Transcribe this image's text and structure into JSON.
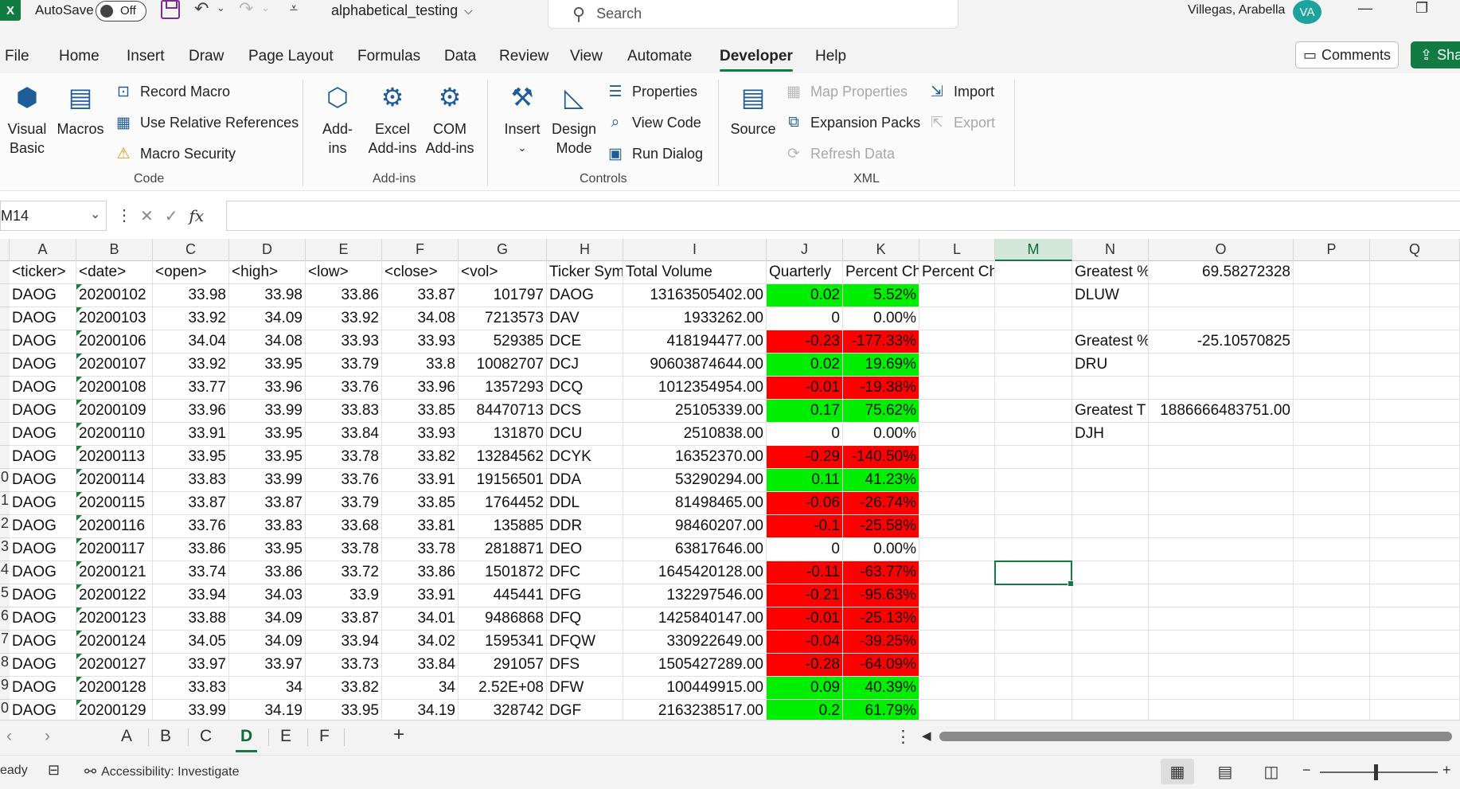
{
  "title_bar": {
    "app_logo": "X",
    "autosave_label": "AutoSave",
    "autosave_state": "Off",
    "doc_name": "alphabetical_testing",
    "search_placeholder": "Search",
    "user_name": "Villegas, Arabella",
    "user_initials": "VA"
  },
  "menu_tabs": [
    {
      "label": "File"
    },
    {
      "label": "Home"
    },
    {
      "label": "Insert"
    },
    {
      "label": "Draw"
    },
    {
      "label": "Page Layout"
    },
    {
      "label": "Formulas"
    },
    {
      "label": "Data"
    },
    {
      "label": "Review"
    },
    {
      "label": "View"
    },
    {
      "label": "Automate"
    },
    {
      "label": "Developer",
      "active": true
    },
    {
      "label": "Help"
    }
  ],
  "header_buttons": {
    "comments": "Comments",
    "share": "Sha"
  },
  "ribbon": {
    "code": {
      "label": "Code",
      "visual_basic_1": "Visual",
      "visual_basic_2": "Basic",
      "macros": "Macros",
      "record_macro": "Record Macro",
      "use_relative": "Use Relative References",
      "macro_security": "Macro Security"
    },
    "addins": {
      "label": "Add-ins",
      "addins_1": "Add-",
      "addins_2": "ins",
      "excel_addins_1": "Excel",
      "excel_addins_2": "Add-ins",
      "com_addins_1": "COM",
      "com_addins_2": "Add-ins"
    },
    "controls": {
      "label": "Controls",
      "insert": "Insert",
      "design_mode_1": "Design",
      "design_mode_2": "Mode",
      "properties": "Properties",
      "view_code": "View Code",
      "run_dialog": "Run Dialog"
    },
    "xml": {
      "label": "XML",
      "source": "Source",
      "map_properties": "Map Properties",
      "expansion_packs": "Expansion Packs",
      "refresh_data": "Refresh Data",
      "import": "Import",
      "export": "Export"
    }
  },
  "name_box": "M14",
  "columns": [
    "A",
    "B",
    "C",
    "D",
    "E",
    "F",
    "G",
    "H",
    "I",
    "J",
    "K",
    "L",
    "M",
    "N",
    "O",
    "P",
    "Q"
  ],
  "selected_column": "M",
  "row_numbers_visible": [
    "",
    "",
    "",
    "",
    "",
    "",
    "",
    "",
    "",
    "0",
    "1",
    "2",
    "3",
    "4",
    "5",
    "6",
    "7",
    "8",
    "9",
    "0"
  ],
  "header_row": [
    "<ticker>",
    "<date>",
    "<open>",
    "<high>",
    "<low>",
    "<close>",
    "<vol>",
    "Ticker Sym",
    "Total Volume",
    "Quarterly",
    "Percent Ch",
    "Percent Change (%)",
    "",
    "Greatest %",
    "69.58272328"
  ],
  "rows": [
    {
      "a": "DAOG",
      "b": "20200102",
      "c": "33.98",
      "d": "33.98",
      "e": "33.86",
      "f": "33.87",
      "g": "101797",
      "h": "DAOG",
      "i": "13163505402.00",
      "j": "0.02",
      "k": "5.52%",
      "status": "green",
      "n": "DLUW",
      "o": ""
    },
    {
      "a": "DAOG",
      "b": "20200103",
      "c": "33.92",
      "d": "34.09",
      "e": "33.92",
      "f": "34.08",
      "g": "7213573",
      "h": "DAV",
      "i": "1933262.00",
      "j": "0",
      "k": "0.00%",
      "status": "none",
      "n": "",
      "o": ""
    },
    {
      "a": "DAOG",
      "b": "20200106",
      "c": "34.04",
      "d": "34.08",
      "e": "33.93",
      "f": "33.93",
      "g": "529385",
      "h": "DCE",
      "i": "418194477.00",
      "j": "-0.23",
      "k": "-177.33%",
      "status": "red",
      "n": "Greatest %",
      "o": "-25.10570825"
    },
    {
      "a": "DAOG",
      "b": "20200107",
      "c": "33.92",
      "d": "33.95",
      "e": "33.79",
      "f": "33.8",
      "g": "10082707",
      "h": "DCJ",
      "i": "90603874644.00",
      "j": "0.02",
      "k": "19.69%",
      "status": "green",
      "n": "DRU",
      "o": ""
    },
    {
      "a": "DAOG",
      "b": "20200108",
      "c": "33.77",
      "d": "33.96",
      "e": "33.76",
      "f": "33.96",
      "g": "1357293",
      "h": "DCQ",
      "i": "1012354954.00",
      "j": "-0.01",
      "k": "-19.38%",
      "status": "red",
      "n": "",
      "o": ""
    },
    {
      "a": "DAOG",
      "b": "20200109",
      "c": "33.96",
      "d": "33.99",
      "e": "33.83",
      "f": "33.85",
      "g": "84470713",
      "h": "DCS",
      "i": "25105339.00",
      "j": "0.17",
      "k": "75.62%",
      "status": "green",
      "n": "Greatest T",
      "o": "1886666483751.00"
    },
    {
      "a": "DAOG",
      "b": "20200110",
      "c": "33.91",
      "d": "33.95",
      "e": "33.84",
      "f": "33.93",
      "g": "131870",
      "h": "DCU",
      "i": "2510838.00",
      "j": "0",
      "k": "0.00%",
      "status": "none",
      "n": "DJH",
      "o": ""
    },
    {
      "a": "DAOG",
      "b": "20200113",
      "c": "33.95",
      "d": "33.95",
      "e": "33.78",
      "f": "33.82",
      "g": "13284562",
      "h": "DCYK",
      "i": "16352370.00",
      "j": "-0.29",
      "k": "-140.50%",
      "status": "red",
      "n": "",
      "o": ""
    },
    {
      "a": "DAOG",
      "b": "20200114",
      "c": "33.83",
      "d": "33.99",
      "e": "33.76",
      "f": "33.91",
      "g": "19156501",
      "h": "DDA",
      "i": "53290294.00",
      "j": "0.11",
      "k": "41.23%",
      "status": "green",
      "n": "",
      "o": ""
    },
    {
      "a": "DAOG",
      "b": "20200115",
      "c": "33.87",
      "d": "33.87",
      "e": "33.79",
      "f": "33.85",
      "g": "1764452",
      "h": "DDL",
      "i": "81498465.00",
      "j": "-0.06",
      "k": "-26.74%",
      "status": "red",
      "n": "",
      "o": ""
    },
    {
      "a": "DAOG",
      "b": "20200116",
      "c": "33.76",
      "d": "33.83",
      "e": "33.68",
      "f": "33.81",
      "g": "135885",
      "h": "DDR",
      "i": "98460207.00",
      "j": "-0.1",
      "k": "-25.58%",
      "status": "red",
      "n": "",
      "o": ""
    },
    {
      "a": "DAOG",
      "b": "20200117",
      "c": "33.86",
      "d": "33.95",
      "e": "33.78",
      "f": "33.78",
      "g": "2818871",
      "h": "DEO",
      "i": "63817646.00",
      "j": "0",
      "k": "0.00%",
      "status": "none",
      "n": "",
      "o": ""
    },
    {
      "a": "DAOG",
      "b": "20200121",
      "c": "33.74",
      "d": "33.86",
      "e": "33.72",
      "f": "33.86",
      "g": "1501872",
      "h": "DFC",
      "i": "1645420128.00",
      "j": "-0.11",
      "k": "-63.77%",
      "status": "red",
      "n": "",
      "o": ""
    },
    {
      "a": "DAOG",
      "b": "20200122",
      "c": "33.94",
      "d": "34.03",
      "e": "33.9",
      "f": "33.91",
      "g": "445441",
      "h": "DFG",
      "i": "132297546.00",
      "j": "-0.21",
      "k": "-95.63%",
      "status": "red",
      "n": "",
      "o": ""
    },
    {
      "a": "DAOG",
      "b": "20200123",
      "c": "33.88",
      "d": "34.09",
      "e": "33.87",
      "f": "34.01",
      "g": "9486868",
      "h": "DFQ",
      "i": "1425840147.00",
      "j": "-0.01",
      "k": "-25.13%",
      "status": "red",
      "n": "",
      "o": ""
    },
    {
      "a": "DAOG",
      "b": "20200124",
      "c": "34.05",
      "d": "34.09",
      "e": "33.94",
      "f": "34.02",
      "g": "1595341",
      "h": "DFQW",
      "i": "330922649.00",
      "j": "-0.04",
      "k": "-39.25%",
      "status": "red",
      "n": "",
      "o": ""
    },
    {
      "a": "DAOG",
      "b": "20200127",
      "c": "33.97",
      "d": "33.97",
      "e": "33.73",
      "f": "33.84",
      "g": "291057",
      "h": "DFS",
      "i": "1505427289.00",
      "j": "-0.28",
      "k": "-64.09%",
      "status": "red",
      "n": "",
      "o": ""
    },
    {
      "a": "DAOG",
      "b": "20200128",
      "c": "33.83",
      "d": "34",
      "e": "33.82",
      "f": "34",
      "g": "2.52E+08",
      "h": "DFW",
      "i": "100449915.00",
      "j": "0.09",
      "k": "40.39%",
      "status": "green",
      "n": "",
      "o": ""
    },
    {
      "a": "DAOG",
      "b": "20200129",
      "c": "33.99",
      "d": "34.19",
      "e": "33.95",
      "f": "34.19",
      "g": "328742",
      "h": "DGF",
      "i": "2163238517.00",
      "j": "0.2",
      "k": "61.79%",
      "status": "green",
      "n": "",
      "o": ""
    }
  ],
  "sheet_tabs": [
    {
      "label": "A"
    },
    {
      "label": "B"
    },
    {
      "label": "C"
    },
    {
      "label": "D",
      "active": true
    },
    {
      "label": "E"
    },
    {
      "label": "F"
    }
  ],
  "status_bar": {
    "ready": "eady",
    "accessibility": "Accessibility: Investigate"
  },
  "icons": {
    "search": "search-icon",
    "undo": "undo-icon",
    "redo": "redo-icon",
    "save": "save-icon"
  },
  "colors": {
    "accent": "#107c41",
    "positive": "#00ee00",
    "negative": "#ff0000"
  }
}
